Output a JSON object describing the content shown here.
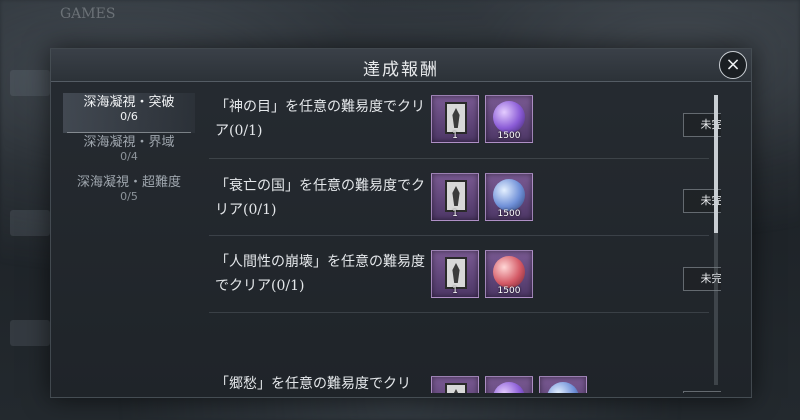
{
  "background": {
    "top_text": "GAMES"
  },
  "dialog": {
    "title": "達成報酬",
    "close_icon": "×"
  },
  "sidebar": {
    "items": [
      {
        "name": "深海凝視・突破",
        "count": "0/6",
        "active": true
      },
      {
        "name": "深海凝視・界域",
        "count": "0/4",
        "active": false
      },
      {
        "name": "深海凝視・超難度",
        "count": "0/5",
        "active": false
      }
    ]
  },
  "tasks": [
    {
      "description": "「神の目」を任意の難易度でクリア(0/1)",
      "rewards": [
        {
          "icon": "card-icon",
          "count": "1"
        },
        {
          "icon": "purple-orb-icon",
          "count": "1500"
        }
      ],
      "status": "未完成"
    },
    {
      "description": "「衰亡の国」を任意の難易度でクリア(0/1)",
      "rewards": [
        {
          "icon": "card-icon",
          "count": "1"
        },
        {
          "icon": "blue-orb-icon",
          "count": "1500"
        }
      ],
      "status": "未完成"
    },
    {
      "description": "「人間性の崩壊」を任意の難易度でクリア(0/1)",
      "rewards": [
        {
          "icon": "card-icon",
          "count": "1"
        },
        {
          "icon": "red-orb-icon",
          "count": "1500"
        }
      ],
      "status": "未完成"
    },
    {
      "description": "「郷愁」を任意の難易度でクリ",
      "rewards": [
        {
          "icon": "card-icon",
          "count": ""
        },
        {
          "icon": "purple-orb-icon",
          "count": ""
        },
        {
          "icon": "blue-orb-icon",
          "count": ""
        }
      ],
      "status": ""
    }
  ],
  "colors": {
    "accent_purple": "#5d4378",
    "panel": "#23282e",
    "text": "#e4e7ea"
  }
}
